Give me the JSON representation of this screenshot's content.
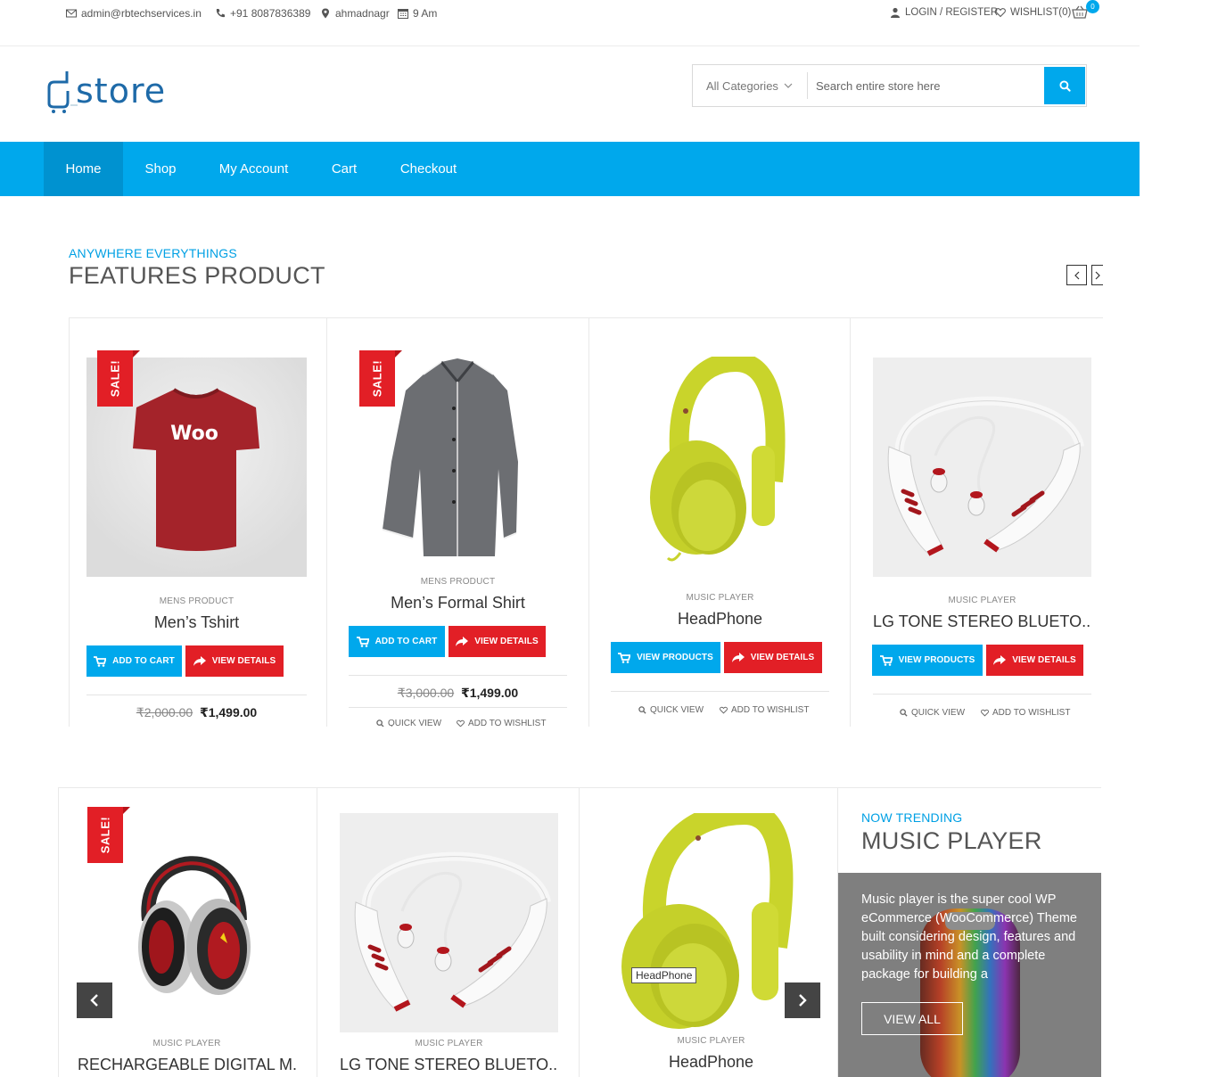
{
  "topbar": {
    "email": "admin@rbtechservices.in",
    "phone": "+91 8087836389",
    "location": "ahmadnagr",
    "time": "9 Am",
    "login": "LOGIN / REGISTER",
    "wishlist": "WISHLIST(0)",
    "cart_count": "0"
  },
  "header": {
    "logo_text": "store",
    "category_select": "All Categories",
    "search_placeholder": "Search entire store here"
  },
  "nav": {
    "items": [
      "Home",
      "Shop",
      "My Account",
      "Cart",
      "Checkout"
    ],
    "active": "Home"
  },
  "featured": {
    "subtitle": "ANYWHERE EVERYTHINGS",
    "title": "FEATURES PRODUCT",
    "products": [
      {
        "category": "MENS PRODUCT",
        "name": "Men’s Tshirt",
        "btn1": "ADD TO CART",
        "btn2": "VIEW DETAILS",
        "old_price": "₹2,000.00",
        "new_price": "₹1,499.00",
        "sale": "SALE!"
      },
      {
        "category": "MENS PRODUCT",
        "name": "Men’s Formal Shirt",
        "btn1": "ADD TO CART",
        "btn2": "VIEW DETAILS",
        "old_price": "₹3,000.00",
        "new_price": "₹1,499.00",
        "sale": "SALE!",
        "quick_view": "QUICK VIEW",
        "wishlist": "ADD TO WISHLIST"
      },
      {
        "category": "MUSIC PLAYER",
        "name": "HeadPhone",
        "btn1": "VIEW PRODUCTS",
        "btn2": "VIEW DETAILS",
        "quick_view": "QUICK VIEW",
        "wishlist": "ADD TO WISHLIST"
      },
      {
        "category": "MUSIC PLAYER",
        "name": "LG TONE STEREO BLUETO...",
        "btn1": "VIEW PRODUCTS",
        "btn2": "VIEW DETAILS",
        "quick_view": "QUICK VIEW",
        "wishlist": "ADD TO WISHLIST"
      }
    ]
  },
  "trending": {
    "products": [
      {
        "category": "MUSIC PLAYER",
        "name": "RECHARGEABLE DIGITAL M...",
        "sale": "SALE!"
      },
      {
        "category": "MUSIC PLAYER",
        "name": "LG TONE STEREO BLUETO..."
      },
      {
        "category": "MUSIC PLAYER",
        "name": "HeadPhone",
        "tooltip": "HeadPhone"
      }
    ],
    "subtitle": "NOW TRENDING",
    "title": "MUSIC PLAYER",
    "description": "Music player is the super cool WP eCommerce (WooCommerce) Theme built considering design, features and usability in mind and a complete package for building a",
    "button": "VIEW ALL"
  },
  "colors": {
    "accent": "#00a8ec",
    "sale": "#e21f26",
    "title": "#555555"
  }
}
